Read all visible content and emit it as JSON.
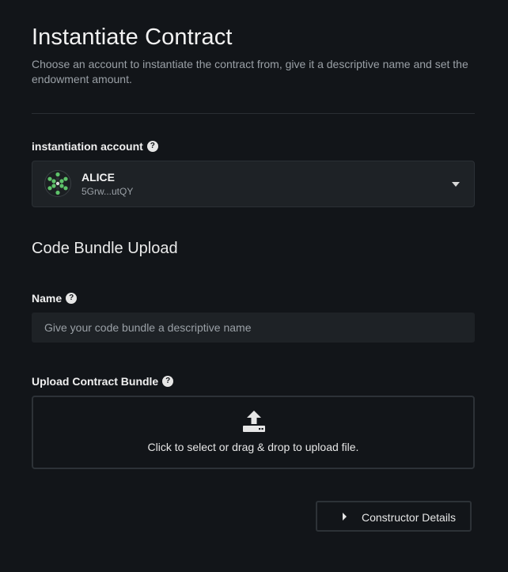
{
  "header": {
    "title": "Instantiate Contract",
    "subtitle": "Choose an account to instantiate the contract from, give it a descriptive name and set the endowment amount."
  },
  "account": {
    "label": "instantiation account",
    "help_icon": "question-circle-icon",
    "selected_name": "ALICE",
    "selected_address": "5Grw...utQY",
    "avatar_icon": "identicon",
    "dropdown_icon": "chevron-down-icon"
  },
  "code_bundle": {
    "section_title": "Code Bundle Upload",
    "name_label": "Name",
    "name_value": "",
    "name_placeholder": "Give your code bundle a descriptive name",
    "upload_label": "Upload Contract Bundle",
    "upload_icon": "upload-icon",
    "upload_text": "Click to select or drag & drop to upload file."
  },
  "constructor": {
    "button_label": "Constructor Details",
    "caret_icon": "caret-right-icon"
  },
  "colors": {
    "background": "#121519",
    "surface": "#1e2226",
    "border": "#2d3237",
    "text_primary": "#f0f0f0",
    "text_muted": "#9aa0a6",
    "identicon_green": "#5ec26a"
  }
}
